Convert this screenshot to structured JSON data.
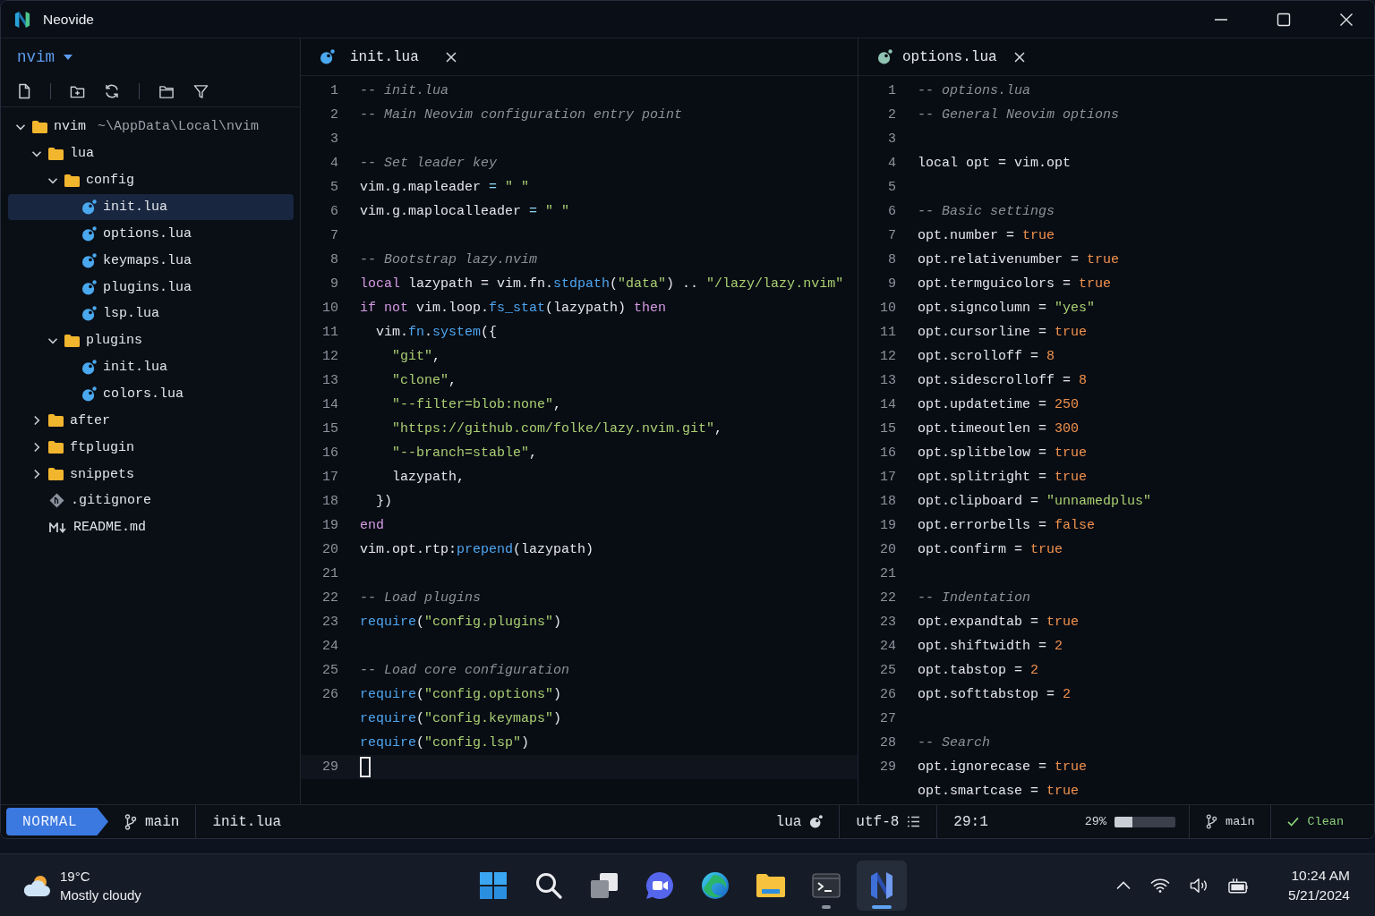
{
  "window": {
    "title": "Neovide"
  },
  "sidebar": {
    "root_label": "nvim",
    "tree": [
      {
        "name": "nvim",
        "kind": "folder",
        "detail": "~\\AppData\\Local\\nvim",
        "expanded": true,
        "selected": false,
        "children": [
          {
            "name": "lua",
            "kind": "folder",
            "expanded": true,
            "selected": false,
            "children": [
              {
                "name": "config",
                "kind": "folder",
                "expanded": true,
                "selected": false,
                "children": [
                  {
                    "name": "init.lua",
                    "kind": "lua",
                    "selected": true
                  },
                  {
                    "name": "options.lua",
                    "kind": "lua",
                    "selected": false
                  },
                  {
                    "name": "keymaps.lua",
                    "kind": "lua",
                    "selected": false
                  },
                  {
                    "name": "plugins.lua",
                    "kind": "lua",
                    "selected": false
                  },
                  {
                    "name": "lsp.lua",
                    "kind": "lua",
                    "selected": false
                  }
                ]
              },
              {
                "name": "plugins",
                "kind": "folder",
                "expanded": true,
                "selected": false,
                "children": [
                  {
                    "name": "init.lua",
                    "kind": "lua",
                    "selected": false
                  },
                  {
                    "name": "colors.lua",
                    "kind": "lua",
                    "selected": false
                  }
                ]
              }
            ]
          },
          {
            "name": "after",
            "kind": "folder",
            "expanded": false,
            "selected": false
          },
          {
            "name": "ftplugin",
            "kind": "folder",
            "expanded": false,
            "selected": false
          },
          {
            "name": "snippets",
            "kind": "folder",
            "expanded": false,
            "selected": false
          },
          {
            "name": ".gitignore",
            "kind": "git",
            "selected": false
          },
          {
            "name": "README.md",
            "kind": "markdown",
            "selected": false
          }
        ]
      }
    ]
  },
  "editors": [
    {
      "active": true,
      "tab": {
        "label": "init.lua"
      },
      "lines": [
        {
          "number": "1",
          "current": false,
          "tokens": [
            {
              "kind": "comment",
              "text": "-- init.lua"
            }
          ]
        },
        {
          "number": "2",
          "current": false,
          "tokens": [
            {
              "kind": "comment",
              "text": "-- Main Neovim configuration entry point"
            }
          ]
        },
        {
          "number": "3",
          "current": false
        },
        {
          "number": "4",
          "current": false,
          "tokens": [
            {
              "kind": "comment",
              "text": "-- Set leader key"
            }
          ]
        },
        {
          "number": "5",
          "current": false,
          "tokens": [
            {
              "kind": "plain",
              "text": "vim.g.mapleader "
            },
            {
              "kind": "op",
              "text": "= "
            },
            {
              "kind": "string",
              "text": "\" \""
            }
          ]
        },
        {
          "number": "6",
          "current": false,
          "tokens": [
            {
              "kind": "plain",
              "text": "vim.g.maplocalleader "
            },
            {
              "kind": "op",
              "text": "= "
            },
            {
              "kind": "string",
              "text": "\" \""
            }
          ]
        },
        {
          "number": "7",
          "current": false
        },
        {
          "number": "8",
          "current": false,
          "tokens": [
            {
              "kind": "comment",
              "text": "-- Bootstrap lazy.nvim"
            }
          ]
        },
        {
          "number": "9",
          "current": false,
          "tokens": [
            {
              "kind": "keyword",
              "text": "local"
            },
            {
              "kind": "plain",
              "text": " lazypath = vim.fn."
            },
            {
              "kind": "func",
              "text": "stdpath"
            },
            {
              "kind": "plain",
              "text": "("
            },
            {
              "kind": "string",
              "text": "\"data\""
            },
            {
              "kind": "plain",
              "text": ") .. "
            },
            {
              "kind": "string",
              "text": "\"/lazy/lazy.nvim\""
            }
          ]
        },
        {
          "number": "10",
          "current": false,
          "tokens": [
            {
              "kind": "keyword",
              "text": "if not"
            },
            {
              "kind": "plain",
              "text": " vim.loop."
            },
            {
              "kind": "func",
              "text": "fs_stat"
            },
            {
              "kind": "plain",
              "text": "(lazypath) "
            },
            {
              "kind": "keyword",
              "text": "then"
            }
          ]
        },
        {
          "number": "11",
          "current": false,
          "tokens": [
            {
              "kind": "plain",
              "text": "  vim."
            },
            {
              "kind": "func",
              "text": "fn"
            },
            {
              "kind": "plain",
              "text": "."
            },
            {
              "kind": "func",
              "text": "system"
            },
            {
              "kind": "plain",
              "text": "({"
            }
          ]
        },
        {
          "number": "12",
          "current": false,
          "tokens": [
            {
              "kind": "string",
              "text": "    \"git\""
            },
            {
              "kind": "plain",
              "text": ","
            }
          ]
        },
        {
          "number": "13",
          "current": false,
          "tokens": [
            {
              "kind": "string",
              "text": "    \"clone\""
            },
            {
              "kind": "plain",
              "text": ","
            }
          ]
        },
        {
          "number": "14",
          "current": false,
          "tokens": [
            {
              "kind": "string",
              "text": "    \"--filter=blob:none\""
            },
            {
              "kind": "plain",
              "text": ","
            }
          ]
        },
        {
          "number": "15",
          "current": false,
          "tokens": [
            {
              "kind": "string",
              "text": "    \"https://github.com/folke/lazy.nvim.git\""
            },
            {
              "kind": "plain",
              "text": ","
            }
          ]
        },
        {
          "number": "16",
          "current": false,
          "tokens": [
            {
              "kind": "string",
              "text": "    \"--branch=stable\""
            },
            {
              "kind": "plain",
              "text": ","
            }
          ]
        },
        {
          "number": "17",
          "current": false,
          "tokens": [
            {
              "kind": "plain",
              "text": "    lazypath,"
            }
          ]
        },
        {
          "number": "18",
          "current": false,
          "tokens": [
            {
              "kind": "plain",
              "text": "  })"
            }
          ]
        },
        {
          "number": "19",
          "current": false,
          "tokens": [
            {
              "kind": "keyword",
              "text": "end"
            }
          ]
        },
        {
          "number": "20",
          "current": false,
          "tokens": [
            {
              "kind": "plain",
              "text": "vim.opt.rtp:"
            },
            {
              "kind": "func",
              "text": "prepend"
            },
            {
              "kind": "plain",
              "text": "(lazypath)"
            }
          ]
        },
        {
          "number": "21",
          "current": false
        },
        {
          "number": "22",
          "current": false,
          "tokens": [
            {
              "kind": "comment",
              "text": "-- Load plugins"
            }
          ]
        },
        {
          "number": "23",
          "current": false,
          "tokens": [
            {
              "kind": "func",
              "text": "require"
            },
            {
              "kind": "plain",
              "text": "("
            },
            {
              "kind": "string",
              "text": "\"config.plugins\""
            },
            {
              "kind": "plain",
              "text": ")"
            }
          ]
        },
        {
          "number": "24",
          "current": false
        },
        {
          "number": "25",
          "current": false,
          "tokens": [
            {
              "kind": "comment",
              "text": "-- Load core configuration"
            }
          ]
        },
        {
          "number": "26",
          "current": false,
          "tokens": [
            {
              "kind": "func",
              "text": "require"
            },
            {
              "kind": "plain",
              "text": "("
            },
            {
              "kind": "string",
              "text": "\"config.options\""
            },
            {
              "kind": "plain",
              "text": ")"
            }
          ]
        },
        {
          "current": false,
          "tokens": [
            {
              "kind": "func",
              "text": "require"
            },
            {
              "kind": "plain",
              "text": "("
            },
            {
              "kind": "string",
              "text": "\"config.keymaps\""
            },
            {
              "kind": "plain",
              "text": ")"
            }
          ]
        },
        {
          "current": false,
          "tokens": [
            {
              "kind": "func",
              "text": "require"
            },
            {
              "kind": "plain",
              "text": "("
            },
            {
              "kind": "string",
              "text": "\"config.lsp\""
            },
            {
              "kind": "plain",
              "text": ")"
            }
          ]
        },
        {
          "number": "29",
          "current": true
        }
      ]
    },
    {
      "active": false,
      "tab": {
        "label": "options.lua"
      },
      "lines": [
        {
          "number": "1",
          "tokens": [
            {
              "kind": "comment",
              "text": "-- options.lua"
            }
          ]
        },
        {
          "number": "2",
          "tokens": [
            {
              "kind": "comment",
              "text": "-- General Neovim options"
            }
          ]
        },
        {
          "number": "3"
        },
        {
          "number": "4",
          "tokens": [
            {
              "kind": "plain",
              "text": "local opt = vim.opt"
            }
          ]
        },
        {
          "number": "5"
        },
        {
          "number": "6",
          "tokens": [
            {
              "kind": "comment",
              "text": "-- Basic settings"
            }
          ]
        },
        {
          "number": "7",
          "tokens": [
            {
              "kind": "plain",
              "text": "opt.number = "
            },
            {
              "kind": "number",
              "text": "true"
            }
          ]
        },
        {
          "number": "8",
          "tokens": [
            {
              "kind": "plain",
              "text": "opt.relativenumber = "
            },
            {
              "kind": "number",
              "text": "true"
            }
          ]
        },
        {
          "number": "9",
          "tokens": [
            {
              "kind": "plain",
              "text": "opt.termguicolors = "
            },
            {
              "kind": "number",
              "text": "true"
            }
          ]
        },
        {
          "number": "10",
          "tokens": [
            {
              "kind": "plain",
              "text": "opt.signcolumn = "
            },
            {
              "kind": "string",
              "text": "\"yes\""
            }
          ]
        },
        {
          "number": "11",
          "tokens": [
            {
              "kind": "plain",
              "text": "opt.cursorline = "
            },
            {
              "kind": "number",
              "text": "true"
            }
          ]
        },
        {
          "number": "12",
          "tokens": [
            {
              "kind": "plain",
              "text": "opt.scrolloff = "
            },
            {
              "kind": "number",
              "text": "8"
            }
          ]
        },
        {
          "number": "13",
          "tokens": [
            {
              "kind": "plain",
              "text": "opt.sidescrolloff = "
            },
            {
              "kind": "number",
              "text": "8"
            }
          ]
        },
        {
          "number": "14",
          "tokens": [
            {
              "kind": "plain",
              "text": "opt.updatetime = "
            },
            {
              "kind": "number",
              "text": "250"
            }
          ]
        },
        {
          "number": "15",
          "tokens": [
            {
              "kind": "plain",
              "text": "opt.timeoutlen = "
            },
            {
              "kind": "number",
              "text": "300"
            }
          ]
        },
        {
          "number": "16",
          "tokens": [
            {
              "kind": "plain",
              "text": "opt.splitbelow = "
            },
            {
              "kind": "number",
              "text": "true"
            }
          ]
        },
        {
          "number": "17",
          "tokens": [
            {
              "kind": "plain",
              "text": "opt.splitright = "
            },
            {
              "kind": "number",
              "text": "true"
            }
          ]
        },
        {
          "number": "18",
          "tokens": [
            {
              "kind": "plain",
              "text": "opt.clipboard = "
            },
            {
              "kind": "string",
              "text": "\"unnamedplus\""
            }
          ]
        },
        {
          "number": "19",
          "tokens": [
            {
              "kind": "plain",
              "text": "opt.errorbells = "
            },
            {
              "kind": "number",
              "text": "false"
            }
          ]
        },
        {
          "number": "20",
          "tokens": [
            {
              "kind": "plain",
              "text": "opt.confirm = "
            },
            {
              "kind": "number",
              "text": "true"
            }
          ]
        },
        {
          "number": "21"
        },
        {
          "number": "22",
          "tokens": [
            {
              "kind": "comment",
              "text": "-- Indentation"
            }
          ]
        },
        {
          "number": "23",
          "tokens": [
            {
              "kind": "plain",
              "text": "opt.expandtab = "
            },
            {
              "kind": "number",
              "text": "true"
            }
          ]
        },
        {
          "number": "24",
          "tokens": [
            {
              "kind": "plain",
              "text": "opt.shiftwidth = "
            },
            {
              "kind": "number",
              "text": "2"
            }
          ]
        },
        {
          "number": "25",
          "tokens": [
            {
              "kind": "plain",
              "text": "opt.tabstop = "
            },
            {
              "kind": "number",
              "text": "2"
            }
          ]
        },
        {
          "number": "26",
          "tokens": [
            {
              "kind": "plain",
              "text": "opt.softtabstop = "
            },
            {
              "kind": "number",
              "text": "2"
            }
          ]
        },
        {
          "number": "27"
        },
        {
          "number": "28",
          "tokens": [
            {
              "kind": "comment",
              "text": "-- Search"
            }
          ]
        },
        {
          "number": "29",
          "tokens": [
            {
              "kind": "plain",
              "text": "opt.ignorecase = "
            },
            {
              "kind": "number",
              "text": "true"
            }
          ]
        },
        {
          "tokens": [
            {
              "kind": "plain",
              "text": "opt.smartcase = "
            },
            {
              "kind": "number",
              "text": "true"
            }
          ]
        }
      ]
    }
  ],
  "status_bar": {
    "mode": "NORMAL",
    "branch": "main",
    "file": "init.lua",
    "filetype": "lua",
    "encoding": "utf-8",
    "position": "29:1",
    "progress": "29%",
    "level": 0.29,
    "vcs_branch": "main",
    "vcs_status": "Clean"
  },
  "taskbar": {
    "weather": {
      "temperature": "19°C",
      "condition": "Mostly cloudy"
    },
    "apps": [
      {
        "kind": "start",
        "running": false,
        "active": false
      },
      {
        "kind": "search",
        "running": false,
        "active": false
      },
      {
        "kind": "task-view",
        "running": false,
        "active": false
      },
      {
        "kind": "chat",
        "running": false,
        "active": false
      },
      {
        "kind": "browser",
        "running": false,
        "active": false
      },
      {
        "kind": "files",
        "running": false,
        "active": false
      },
      {
        "kind": "terminal",
        "running": true,
        "active": false
      },
      {
        "kind": "neovide",
        "running": true,
        "active": true
      }
    ],
    "clock": {
      "time": "10:24 AM",
      "date": "5/21/2024"
    }
  }
}
